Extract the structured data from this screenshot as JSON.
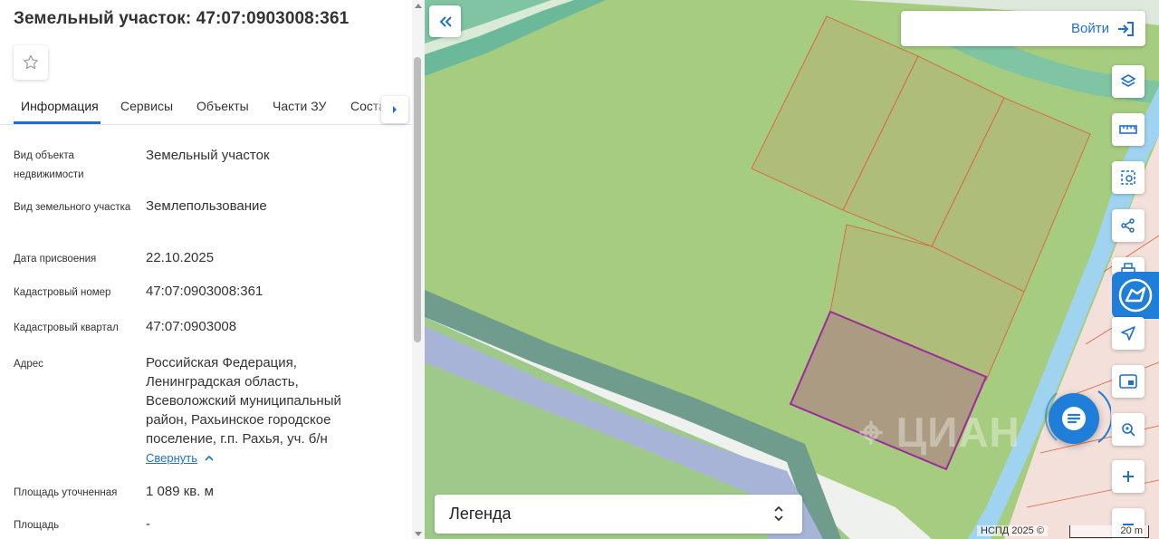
{
  "panel": {
    "title": "Земельный участок: 47:07:0903008:361",
    "tabs": [
      "Информация",
      "Сервисы",
      "Объекты",
      "Части ЗУ",
      "Соста"
    ],
    "rows": [
      {
        "label": "Вид объекта недвижимости",
        "value": "Земельный участок"
      },
      {
        "label": "Вид земельного участка",
        "value": "Землепользование"
      },
      {
        "label": "Дата присвоения",
        "value": "22.10.2025"
      },
      {
        "label": "Кадастровый номер",
        "value": "47:07:0903008:361"
      },
      {
        "label": "Кадастровый квартал",
        "value": "47:07:0903008"
      },
      {
        "label": "Адрес",
        "value": "Российская Федерация, Ленинградская область, Всеволожский муниципальный район, Рахьинское городское поселение, г.п. Рахья, уч. б/н"
      },
      {
        "label": "Площадь уточненная",
        "value": "1 089 кв. м"
      },
      {
        "label": "Площадь",
        "value": "-"
      }
    ],
    "collapse_label": "Свернуть"
  },
  "map": {
    "login_label": "Войти",
    "legend_label": "Легенда",
    "copyright": "НСПД 2025 ©",
    "scale_label": "20 m",
    "tools": [
      "layers-icon",
      "ruler-icon",
      "select-area-icon",
      "share-icon",
      "print-icon",
      "locate-icon",
      "minimap-icon",
      "search-area-icon",
      "zoom-in-icon",
      "zoom-out-icon"
    ]
  },
  "colors": {
    "accent": "#1f6fd1",
    "land": "#a6cd7f",
    "selected_parcel": "#9b2a9b",
    "parcel_border": "#e0603a",
    "water": "#9fd3ef"
  }
}
